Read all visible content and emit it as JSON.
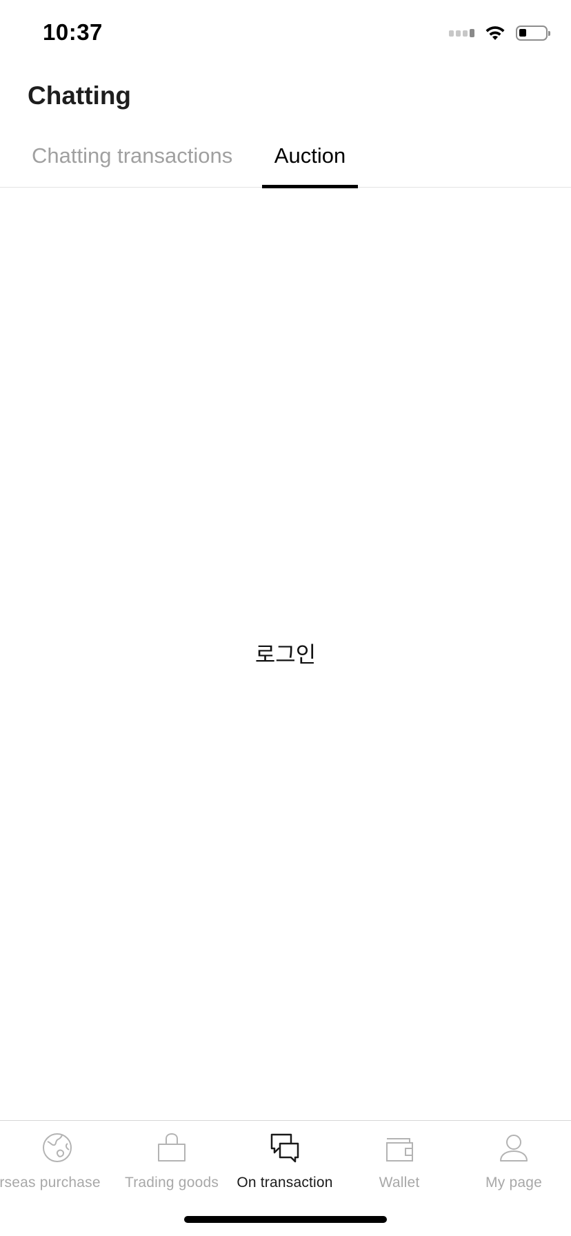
{
  "status_bar": {
    "time": "10:37"
  },
  "header": {
    "title": "Chatting"
  },
  "tabs": [
    {
      "label": "Chatting transactions",
      "active": false
    },
    {
      "label": "Auction",
      "active": true
    }
  ],
  "main": {
    "login_text": "로그인"
  },
  "bottom_nav": {
    "items": [
      {
        "label": "Overseas purchase",
        "icon": "globe-icon",
        "active": false
      },
      {
        "label": "Trading goods",
        "icon": "shopping-bag-icon",
        "active": false
      },
      {
        "label": "On transaction",
        "icon": "chat-bubbles-icon",
        "active": true
      },
      {
        "label": "Wallet",
        "icon": "wallet-icon",
        "active": false
      },
      {
        "label": "My page",
        "icon": "person-icon",
        "active": false
      }
    ]
  },
  "colors": {
    "active": "#1a1a1a",
    "inactive": "#a8a8a8",
    "tab_inactive": "#a0a0a0",
    "divider": "#e3e3e3"
  }
}
